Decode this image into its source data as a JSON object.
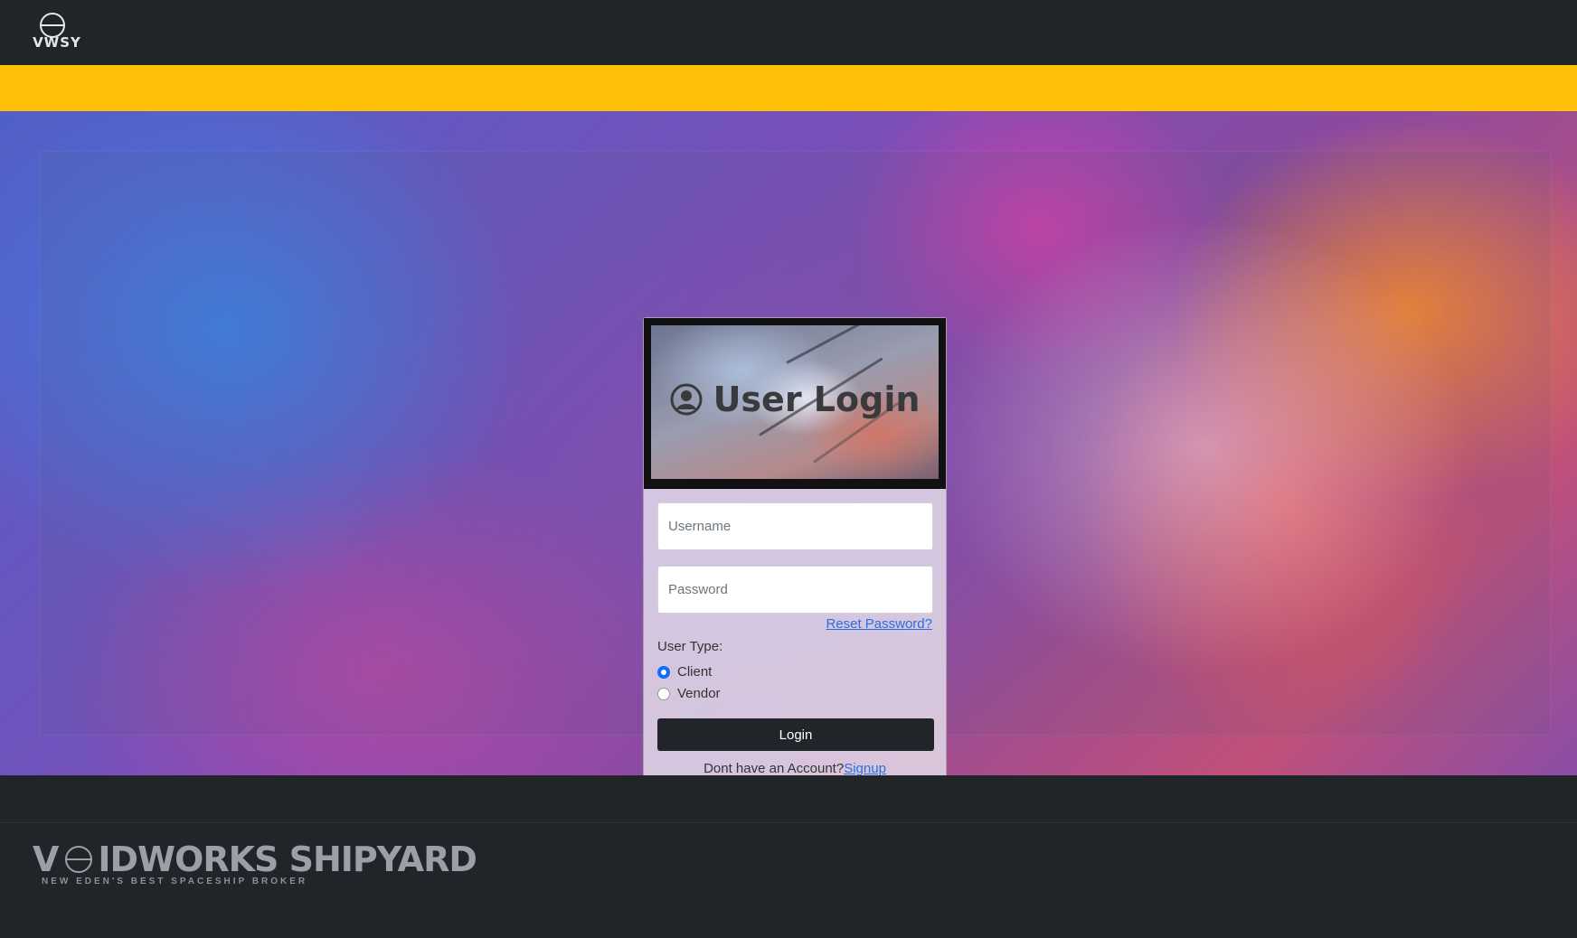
{
  "header": {
    "logo_text": "VWSY"
  },
  "login": {
    "title": "User Login",
    "username_placeholder": "Username",
    "password_placeholder": "Password",
    "reset_link": "Reset Password?",
    "user_type_label": "User Type:",
    "user_types": [
      {
        "label": "Client",
        "selected": true
      },
      {
        "label": "Vendor",
        "selected": false
      }
    ],
    "login_button": "Login",
    "signup_prompt": "Dont have an Account?",
    "signup_link": "Signup"
  },
  "footer": {
    "brand_first": "V",
    "brand_rest": "IDWORKS SHIPYARD",
    "tagline": "NEW EDEN'S BEST SPACESHIP BROKER"
  },
  "colors": {
    "topbar": "#212429",
    "accent_bar": "#ffc107",
    "link": "#2a6fe0",
    "button": "#212529",
    "radio_selected": "#0d6efd"
  },
  "icons": [
    "user-circle-icon"
  ]
}
